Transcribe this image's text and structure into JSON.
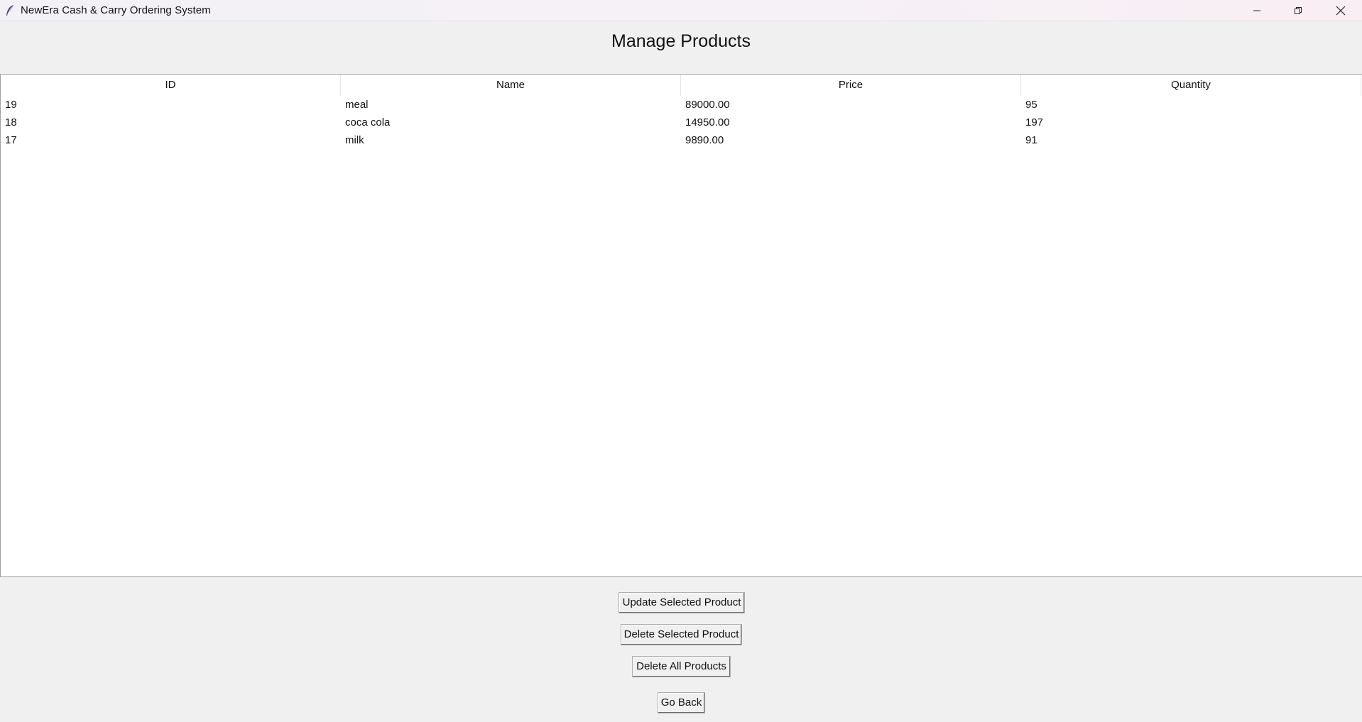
{
  "window": {
    "title": "NewEra Cash & Carry Ordering System",
    "app_icon": "feather-icon",
    "controls": {
      "minimize_icon": "minimize-icon",
      "maximize_icon": "restore-icon",
      "close_icon": "close-icon"
    }
  },
  "page": {
    "heading": "Manage Products"
  },
  "table": {
    "columns": [
      "ID",
      "Name",
      "Price",
      "Quantity"
    ],
    "rows": [
      {
        "id": "19",
        "name": "meal",
        "price": "89000.00",
        "quantity": "95"
      },
      {
        "id": "18",
        "name": "coca cola",
        "price": "14950.00",
        "quantity": "197"
      },
      {
        "id": "17",
        "name": "milk",
        "price": "9890.00",
        "quantity": "91"
      }
    ]
  },
  "actions": {
    "update_label": "Update Selected Product",
    "delete_selected_label": "Delete Selected Product",
    "delete_all_label": "Delete All Products",
    "go_back_label": "Go Back"
  }
}
